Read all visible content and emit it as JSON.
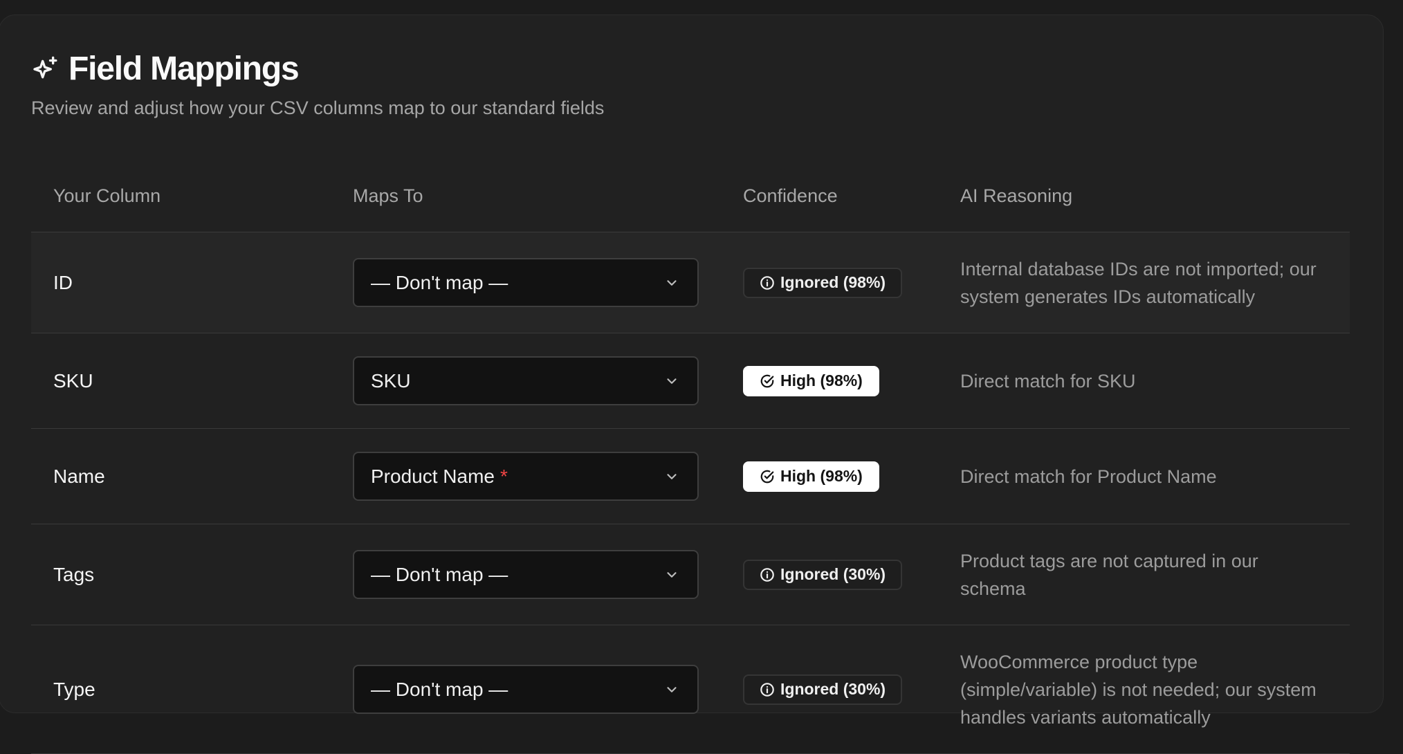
{
  "header": {
    "title": "Field Mappings",
    "subtitle": "Review and adjust how your CSV columns map to our standard fields",
    "icon": "sparkle-icon"
  },
  "table": {
    "columns": [
      "Your Column",
      "Maps To",
      "Confidence",
      "AI Reasoning"
    ],
    "rows": [
      {
        "column": "ID",
        "maps_to": "— Don't map —",
        "required": "",
        "confidence": "Ignored (98%)",
        "confidence_type": "ignored",
        "reasoning": "Internal database IDs are not imported; our system generates IDs automatically"
      },
      {
        "column": "SKU",
        "maps_to": "SKU",
        "required": "",
        "confidence": "High (98%)",
        "confidence_type": "high",
        "reasoning": "Direct match for SKU"
      },
      {
        "column": "Name",
        "maps_to": "Product Name",
        "required": "*",
        "confidence": "High (98%)",
        "confidence_type": "high",
        "reasoning": "Direct match for Product Name"
      },
      {
        "column": "Tags",
        "maps_to": "— Don't map —",
        "required": "",
        "confidence": "Ignored (30%)",
        "confidence_type": "ignored",
        "reasoning": "Product tags are not captured in our schema"
      },
      {
        "column": "Type",
        "maps_to": "— Don't map —",
        "required": "",
        "confidence": "Ignored (30%)",
        "confidence_type": "ignored",
        "reasoning": "WooCommerce product type (simple/variable) is not needed; our system handles variants automatically"
      }
    ]
  },
  "colors": {
    "background": "#1c1c1c",
    "card": "#212121",
    "required_asterisk": "#ef4444",
    "high_badge": "#ffffff"
  }
}
